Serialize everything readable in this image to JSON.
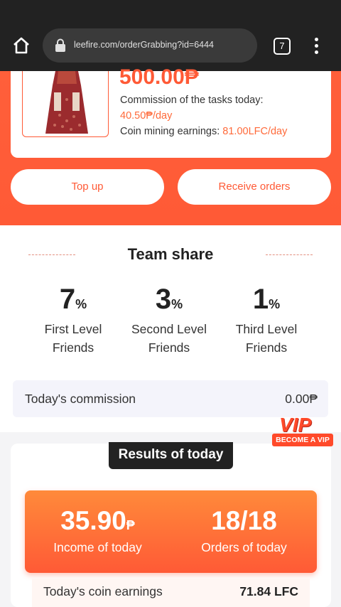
{
  "browser": {
    "url": "leefire.com/orderGrabbing?id=6444",
    "tab_count": "7"
  },
  "product": {
    "price": "500.00₱",
    "commission_label": "Commission of the tasks today:",
    "commission_value": "40.50₱/day",
    "mining_label": "Coin mining earnings: ",
    "mining_value": "81.00LFC/day"
  },
  "actions": {
    "top_up": "Top up",
    "receive_orders": "Receive orders"
  },
  "team_share": {
    "title": "Team share",
    "levels": [
      {
        "value": "7",
        "unit": "%",
        "label_line1": "First Level",
        "label_line2": "Friends"
      },
      {
        "value": "3",
        "unit": "%",
        "label_line1": "Second Level",
        "label_line2": "Friends"
      },
      {
        "value": "1",
        "unit": "%",
        "label_line1": "Third Level",
        "label_line2": "Friends"
      }
    ],
    "commission_label": "Today's commission",
    "commission_value": "0.00₱"
  },
  "vip": {
    "title": "VIP",
    "button": "BECOME A VIP"
  },
  "results": {
    "title": "Results of today",
    "income_value": "35.90",
    "income_unit": "₱",
    "income_label": "Income of today",
    "orders_value": "18/18",
    "orders_label": "Orders of today",
    "coin_label": "Today's coin earnings",
    "coin_value": "71.84 LFC"
  },
  "colors": {
    "accent": "#ff5a36",
    "dark": "#222222"
  }
}
